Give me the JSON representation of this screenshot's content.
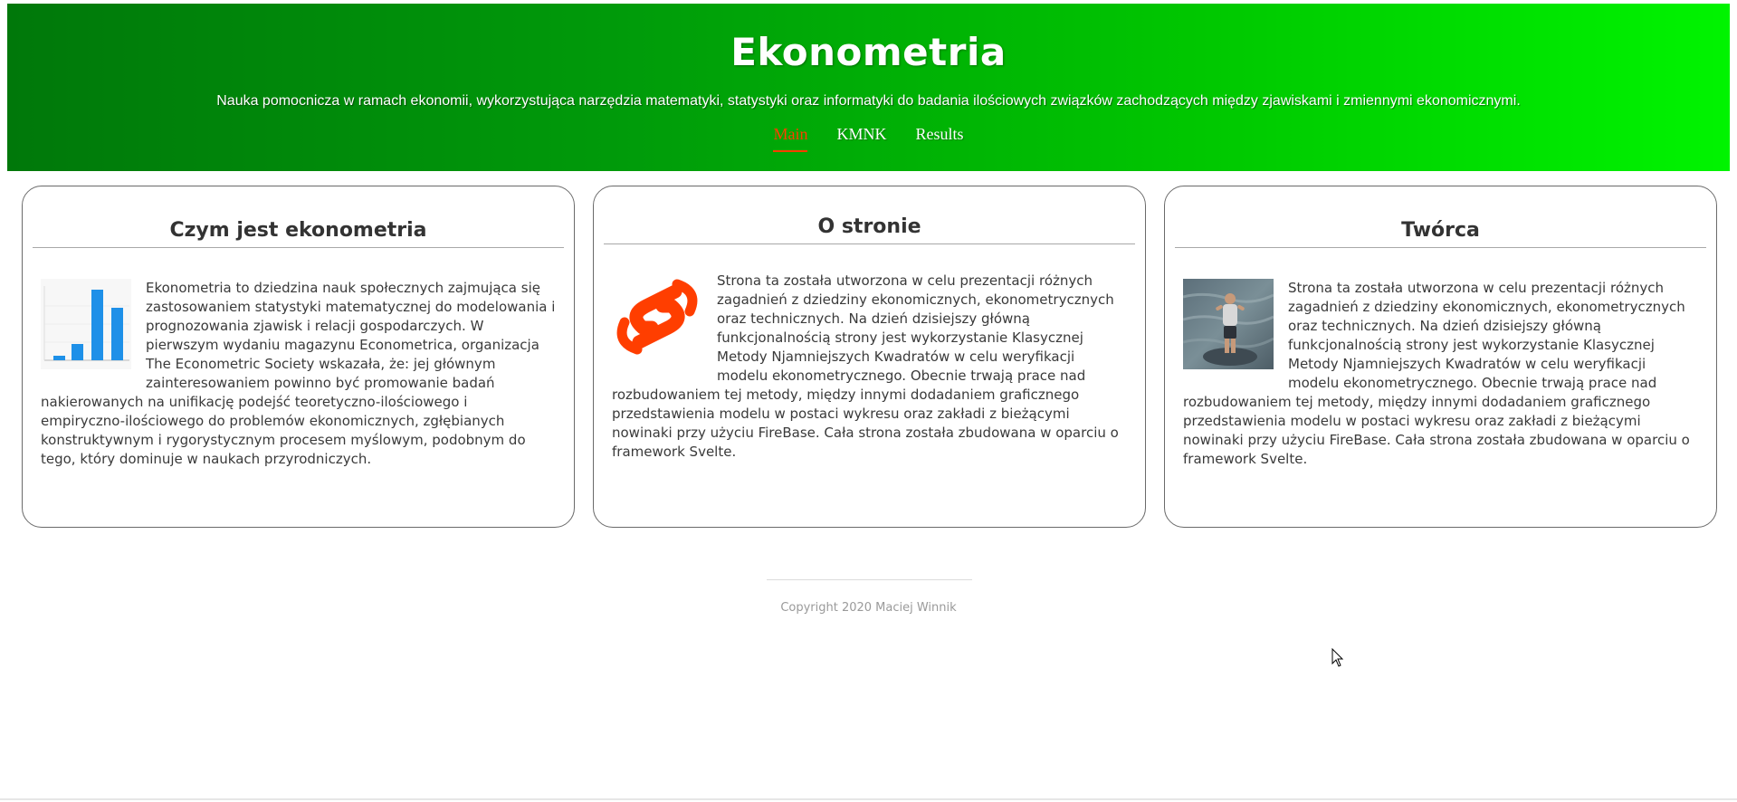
{
  "header": {
    "title": "Ekonometria",
    "subtitle": "Nauka pomocnicza w ramach ekonomii, wykorzystująca narzędzia matematyki, statystyki oraz informatyki do badania ilościowych związków zachodzących między zjawiskami i zmiennymi ekonomicznymi.",
    "nav": [
      {
        "label": "Main",
        "active": true
      },
      {
        "label": "KMNK",
        "active": false
      },
      {
        "label": "Results",
        "active": false
      }
    ]
  },
  "cards": [
    {
      "title": "Czym jest ekonometria",
      "image": "bar-chart-thumbnail",
      "text": "Ekonometria to dziedzina nauk społecznych zajmująca się zastosowaniem statystyki matematycznej do modelowania i prognozowania zjawisk i relacji gospodarczych. W pierwszym wydaniu magazynu Econometrica, organizacja The Econometric Society wskazała, że: jej głównym zainteresowaniem powinno być promowanie badań nakierowanych na unifikację podejść teoretyczno-ilościowego i empiryczno-ilościowego do problemów ekonomicznych, zgłębianych konstruktywnym i rygorystycznym procesem myślowym, podobnym do tego, który dominuje w naukach przyrodniczych."
    },
    {
      "title": "O stronie",
      "image": "svelte-logo",
      "text": "Strona ta została utworzona w celu prezentacji różnych zagadnień z dziedziny ekonomicznych, ekonometrycznych oraz technicznych. Na dzień dzisiejszy główną funkcjonalnością strony jest wykorzystanie Klasycznej Metody Njamniejszych Kwadratów w celu weryfikacji modelu ekonometrycznego. Obecnie trwają prace nad rozbudowaniem tej metody, między innymi dodadaniem graficznego przedstawienia modelu w postaci wykresu oraz zakładi z bieżącymi nowinaki przy użyciu FireBase. Cała strona została zbudowana w oparciu o framework Svelte."
    },
    {
      "title": "Twórca",
      "image": "author-photo",
      "text": "Strona ta została utworzona w celu prezentacji różnych zagadnień z dziedziny ekonomicznych, ekonometrycznych oraz technicznych. Na dzień dzisiejszy główną funkcjonalnością strony jest wykorzystanie Klasycznej Metody Njamniejszych Kwadratów w celu weryfikacji modelu ekonometrycznego. Obecnie trwają prace nad rozbudowaniem tej metody, między innymi dodadaniem graficznego przedstawienia modelu w postaci wykresu oraz zakładi z bieżącymi nowinaki przy użyciu FireBase. Cała strona została zbudowana w oparciu o framework Svelte."
    }
  ],
  "footer": {
    "copyright": "Copyright 2020 Maciej Winnik"
  },
  "colors": {
    "accent": "#ff3e00",
    "header_start": "#00780a",
    "header_end": "#00f400"
  }
}
